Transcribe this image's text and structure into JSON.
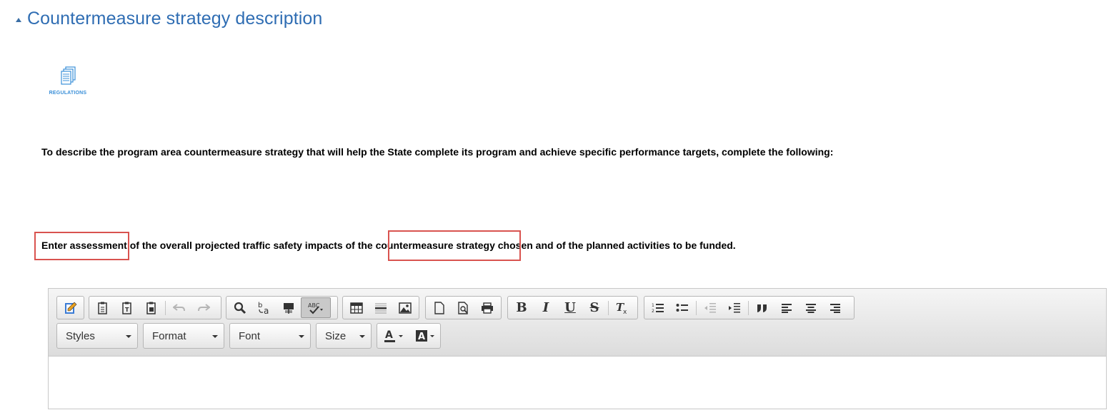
{
  "section": {
    "title": "Countermeasure strategy description"
  },
  "regulations_icon": {
    "label": "REGULATIONS"
  },
  "instructions": {
    "line1": "To describe the program area countermeasure strategy that will help the State complete its program and achieve specific performance targets, complete the following:",
    "line2": "Enter assessment of the overall projected traffic safety impacts of the countermeasure strategy chosen and of the planned activities to be funded."
  },
  "highlight_color": "#d9534f",
  "editor": {
    "toolbar": {
      "styles_label": "Styles",
      "format_label": "Format",
      "font_label": "Font",
      "size_label": "Size",
      "bold_glyph": "B",
      "italic_glyph": "I",
      "underline_glyph": "U",
      "strike_glyph": "S"
    },
    "content": ""
  }
}
